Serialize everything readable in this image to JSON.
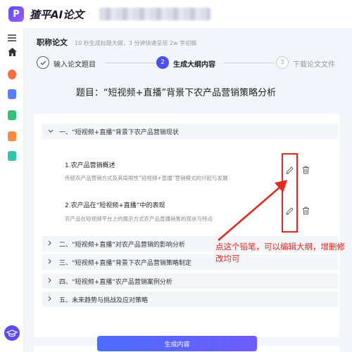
{
  "app": {
    "logo_mark": "P",
    "name": "猹平AI论文"
  },
  "header": {
    "title": "职称论文",
    "subtitle": "10 秒生成标题大纲，3 分钟快速呈现 2w 字初稿"
  },
  "steps": [
    {
      "num": "",
      "label": "输入论文题目",
      "state": "done"
    },
    {
      "num": "2",
      "label": "生成大纲内容",
      "state": "active"
    },
    {
      "num": "3",
      "label": "下载论文文件",
      "state": "pending"
    }
  ],
  "paper_title": "题目：“短视频+直播”背景下农产品营销策略分析",
  "outline": {
    "sections": [
      {
        "label": "一、“短视频+直播”背景下农产品营销现状",
        "expanded": true
      },
      {
        "label": "二、“短视频+直播”对农产品营销的影响分析",
        "expanded": false
      },
      {
        "label": "三、“短视频+直播”背景下农产品营销策略制定",
        "expanded": false
      },
      {
        "label": "四、“短视频+直播”农产品营销案例分析",
        "expanded": false
      },
      {
        "label": "五、未来趋势与挑战及应对策略",
        "expanded": false
      }
    ],
    "subsections": [
      {
        "title": "1.农产品营销概述",
        "desc": "传统农产品营销方式及其局限性“短视频+直播”营销模式的兴起与发展"
      },
      {
        "title": "2.农产品在“短视频+直播”中的表现",
        "desc": "农产品在短视频平台上的展示方式农产品直播销售的现状与特点"
      }
    ]
  },
  "annotation": "点这个铅笔，可以编辑大纲，增删修改均可",
  "generate_button": "生成内容",
  "icons": {
    "menu": "menu-icon",
    "home": "home-icon",
    "edit": "pencil-icon",
    "delete": "trash-icon",
    "expand": "chevron-down-icon",
    "collapse": "chevron-right-icon"
  },
  "colors": {
    "accent": "#4b4ff0",
    "annotation_red": "#e8261e",
    "step_done": "#5a5a6e"
  }
}
